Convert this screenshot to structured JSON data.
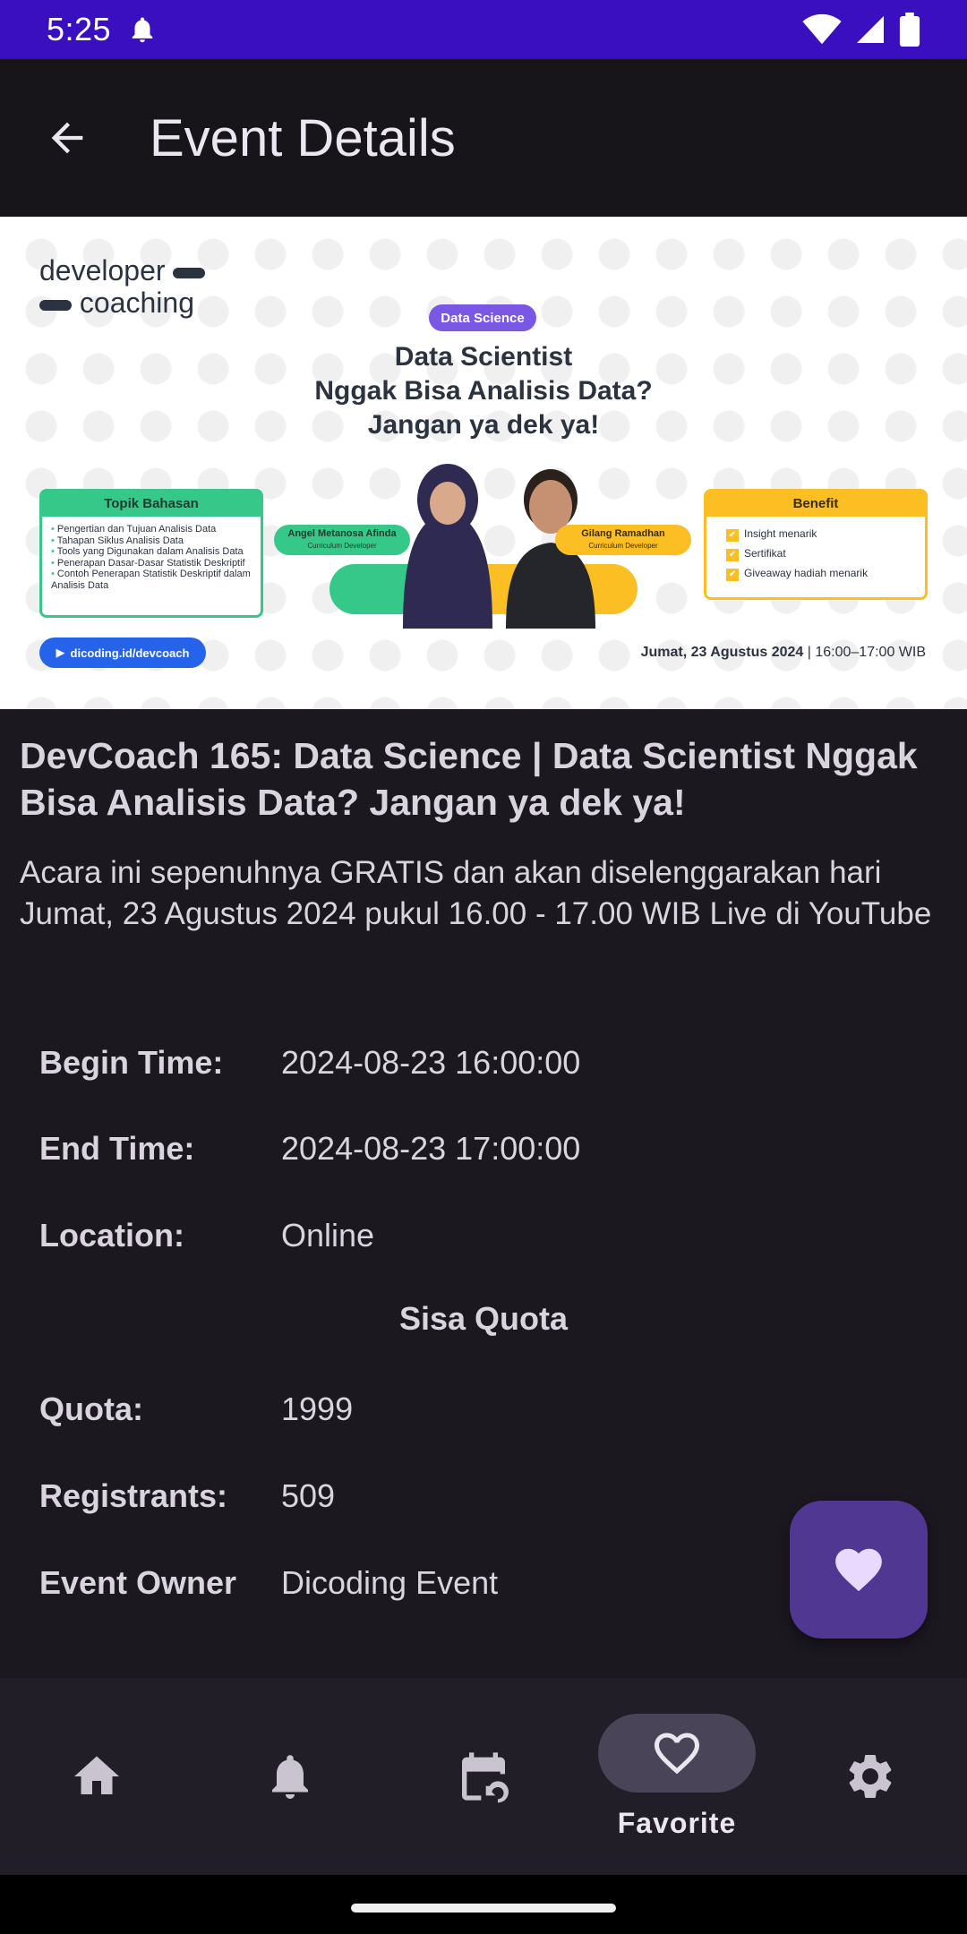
{
  "status_bar": {
    "time": "5:25"
  },
  "app_bar": {
    "title": "Event Details"
  },
  "banner": {
    "brand_line1": "developer",
    "brand_line2": "coaching",
    "tag": "Data Science",
    "title_line1": "Data Scientist",
    "title_line2": "Nggak Bisa Analisis Data?",
    "title_line3": "Jangan ya dek ya!",
    "topik_heading": "Topik Bahasan",
    "topik_items": [
      "Pengertian dan Tujuan Analisis Data",
      "Tahapan Siklus Analisis Data",
      "Tools yang Digunakan dalam Analisis Data",
      "Penerapan Dasar-Dasar Statistik Deskriptif",
      "Contoh Penerapan Statistik Deskriptif dalam Analisis Data"
    ],
    "benefit_heading": "Benefit",
    "benefit_items": [
      "Insight menarik",
      "Sertifikat",
      "Giveaway hadiah menarik"
    ],
    "speaker1_name": "Angel Metanosa Afinda",
    "speaker1_role": "Curriculum Developer",
    "speaker2_name": "Gilang Ramadhan",
    "speaker2_role": "Curriculum Developer",
    "link": "dicoding.id/devcoach",
    "date_bold": "Jumat, 23 Agustus 2024",
    "date_time": " | 16:00–17:00 WIB"
  },
  "event": {
    "title": "DevCoach 165: Data Science | Data Scientist Nggak Bisa Analisis Data? Jangan ya dek ya!",
    "summary": "Acara ini sepenuhnya GRATIS dan akan diselenggarakan hari Jumat, 23 Agustus 2024 pukul 16.00 - 17.00 WIB Live di YouTube"
  },
  "details": {
    "begin_label": "Begin Time:",
    "begin_value": "2024-08-23 16:00:00",
    "end_label": "End Time:",
    "end_value": "2024-08-23 17:00:00",
    "location_label": "Location:",
    "location_value": "Online",
    "section_heading": "Sisa Quota",
    "quota_label": "Quota:",
    "quota_value": "1999",
    "registrants_label": "Registrants:",
    "registrants_value": "509",
    "owner_label": "Event Owner",
    "owner_value": "Dicoding Event"
  },
  "bottom_nav": {
    "items": [
      {
        "icon": "home-icon"
      },
      {
        "icon": "bell-icon"
      },
      {
        "icon": "calendar-history-icon"
      },
      {
        "icon": "heart-icon",
        "label": "Favorite",
        "selected": true
      },
      {
        "icon": "gear-icon"
      }
    ]
  },
  "colors": {
    "status_bar": "#3a0fbf",
    "app_bar": "#17151a",
    "background": "#1b1820",
    "fab": "#4f3792",
    "fab_icon": "#ead9ff",
    "nav_background": "#221e28",
    "nav_indicator": "#4a4458"
  }
}
